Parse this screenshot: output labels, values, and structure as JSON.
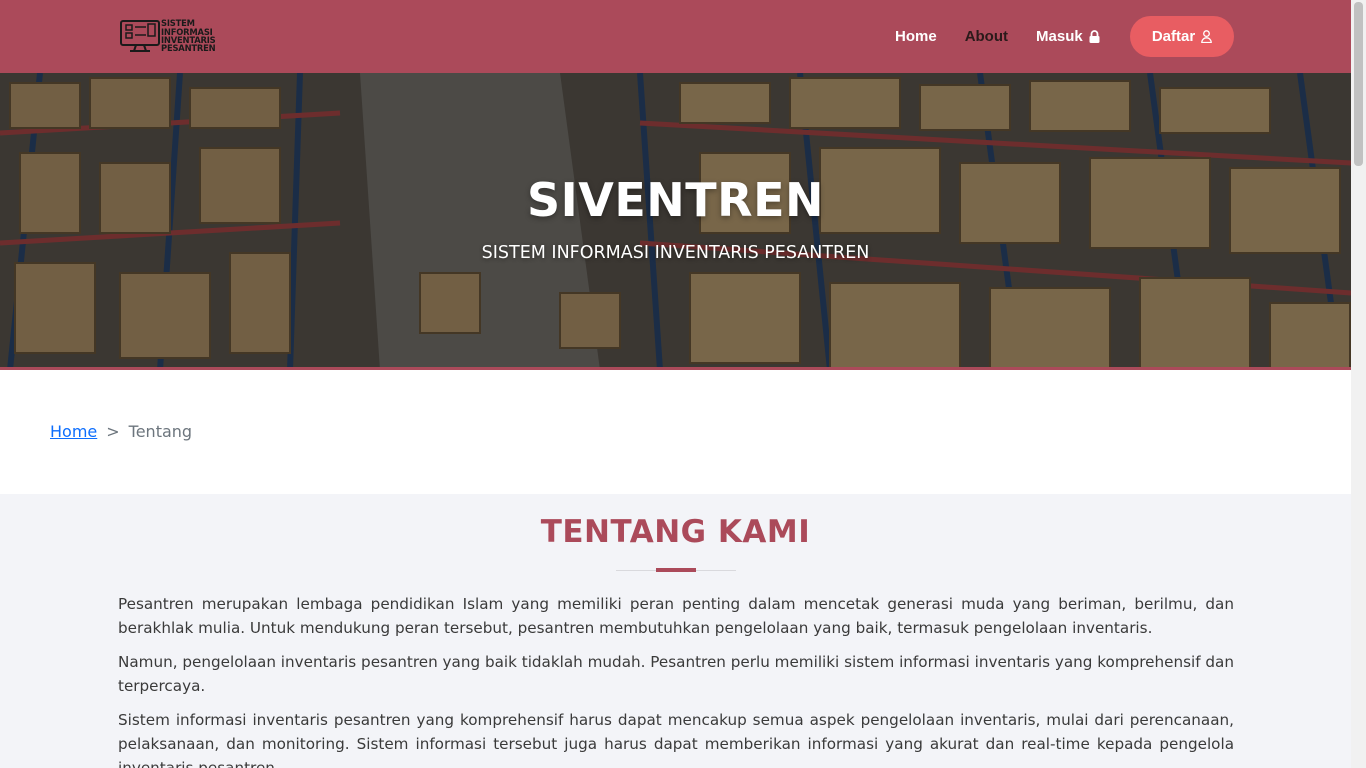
{
  "header": {
    "logo_text_lines": [
      "SISTEM",
      "INFORMASI",
      "INVENTARIS",
      "PESANTREN"
    ],
    "nav": [
      {
        "label": "Home"
      },
      {
        "label": "About"
      },
      {
        "label": "Masuk",
        "icon": "lock-icon"
      }
    ],
    "register_button": {
      "label": "Daftar",
      "icon": "user-icon"
    }
  },
  "hero": {
    "title": "SIVENTREN",
    "subtitle": "SISTEM INFORMASI INVENTARIS PESANTREN"
  },
  "breadcrumb": {
    "home": "Home",
    "separator": ">",
    "current": "Tentang"
  },
  "about": {
    "title": "TENTANG KAMI",
    "paragraphs": [
      "Pesantren merupakan lembaga pendidikan Islam yang memiliki peran penting dalam mencetak generasi muda yang beriman, berilmu, dan berakhlak mulia. Untuk mendukung peran tersebut, pesantren membutuhkan pengelolaan yang baik, termasuk pengelolaan inventaris.",
      "Namun, pengelolaan inventaris pesantren yang baik tidaklah mudah. Pesantren perlu memiliki sistem informasi inventaris yang komprehensif dan terpercaya.",
      "Sistem informasi inventaris pesantren yang komprehensif harus dapat mencakup semua aspek pengelolaan inventaris, mulai dari perencanaan, pelaksanaan, dan monitoring. Sistem informasi tersebut juga harus dapat memberikan informasi yang akurat dan real-time kepada pengelola inventaris pesantren."
    ]
  },
  "colors": {
    "brand": "#ab4a5a",
    "button": "#e85d62",
    "link": "#0d6efd",
    "section_bg": "#f3f4f8"
  }
}
